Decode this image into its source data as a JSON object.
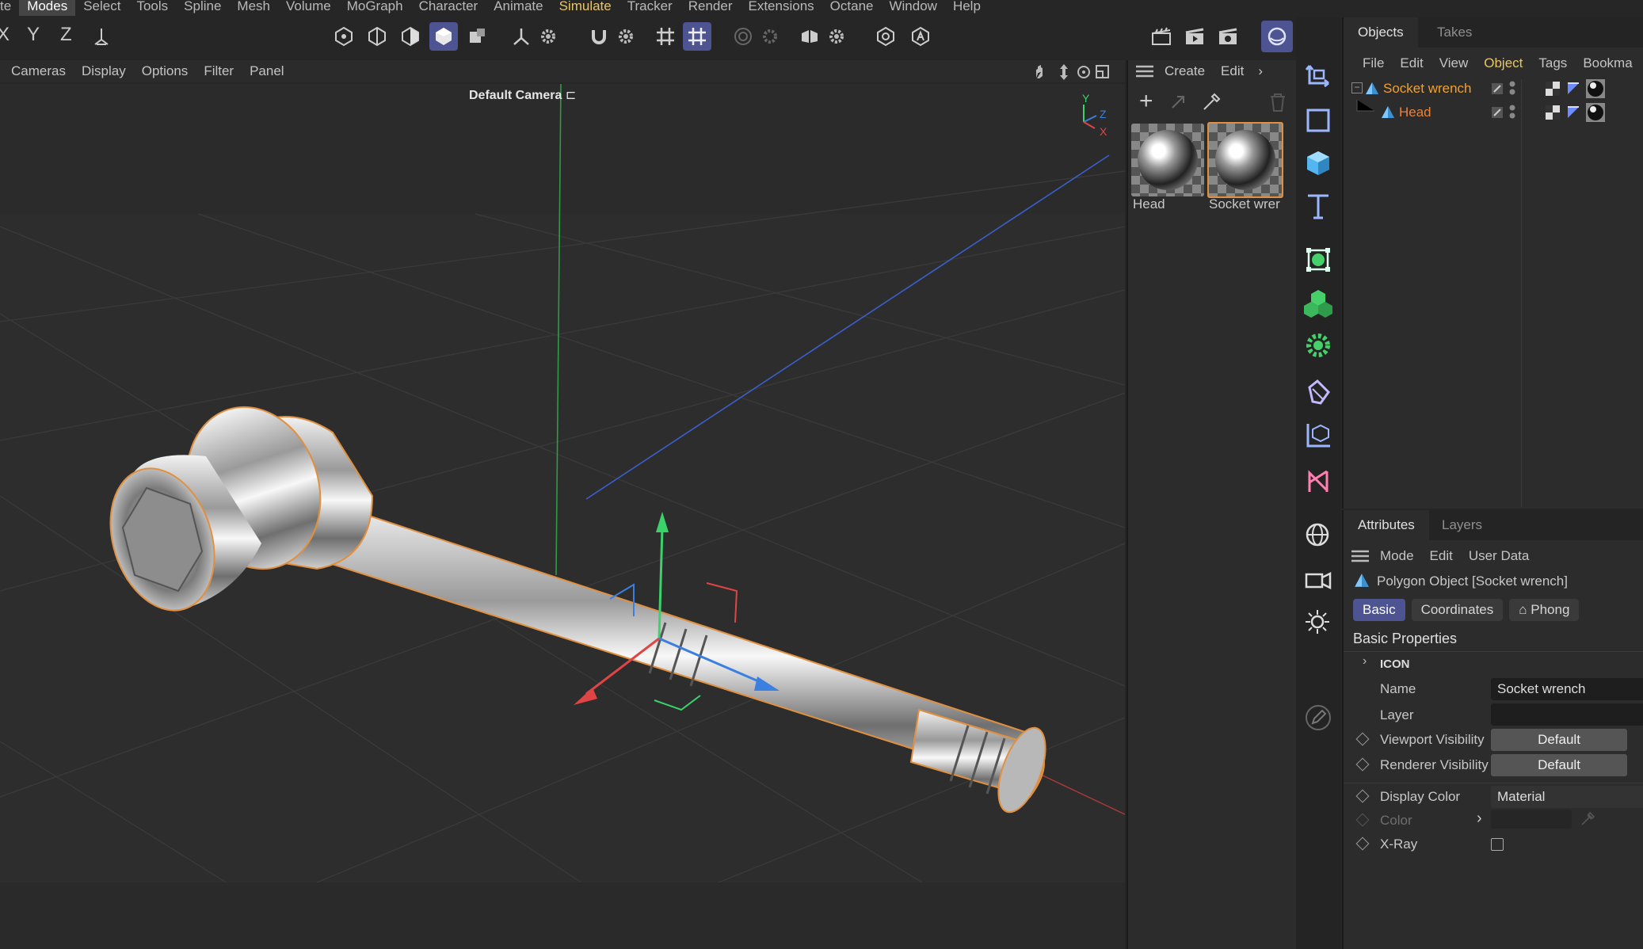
{
  "menu": [
    "te",
    "Modes",
    "Select",
    "Tools",
    "Spline",
    "Mesh",
    "Volume",
    "MoGraph",
    "Character",
    "Animate",
    "Simulate",
    "Tracker",
    "Render",
    "Extensions",
    "Octane",
    "Window",
    "Help"
  ],
  "toolbar": {
    "axis_x": "X",
    "axis_y": "Y",
    "axis_z": "Z"
  },
  "viewport_menu": [
    "Cameras",
    "Display",
    "Options",
    "Filter",
    "Panel"
  ],
  "viewport": {
    "camera_label": "Default Camera",
    "axis_y": "Y",
    "axis_z": "Z",
    "axis_x": "X"
  },
  "materials": {
    "menu": [
      "Create",
      "Edit"
    ],
    "items": [
      {
        "name": "Head"
      },
      {
        "name": "Socket wrer"
      }
    ]
  },
  "objects_panel": {
    "tabs": [
      "Objects",
      "Takes"
    ],
    "menu": [
      "File",
      "Edit",
      "View",
      "Object",
      "Tags",
      "Bookma"
    ],
    "tree": [
      {
        "name": "Socket wrench",
        "color": "#f0a030"
      },
      {
        "name": "Head",
        "color": "#e8823a"
      }
    ]
  },
  "attributes_panel": {
    "tabs": [
      "Attributes",
      "Layers"
    ],
    "menu": [
      "Mode",
      "Edit",
      "User Data"
    ],
    "object_title": "Polygon Object [Socket wrench]",
    "subtabs": [
      "Basic",
      "Coordinates",
      "Phong"
    ],
    "section": "Basic Properties",
    "group": "ICON",
    "fields": {
      "name_label": "Name",
      "name_value": "Socket wrench",
      "layer_label": "Layer",
      "viewport_vis_label": "Viewport Visibility",
      "viewport_vis_value": "Default",
      "renderer_vis_label": "Renderer Visibility",
      "renderer_vis_value": "Default",
      "display_color_label": "Display Color",
      "display_color_value": "Material",
      "color_label": "Color",
      "xray_label": "X-Ray"
    }
  },
  "colors": {
    "accent": "#4d5491",
    "selection": "#e09040",
    "background": "#262626"
  }
}
